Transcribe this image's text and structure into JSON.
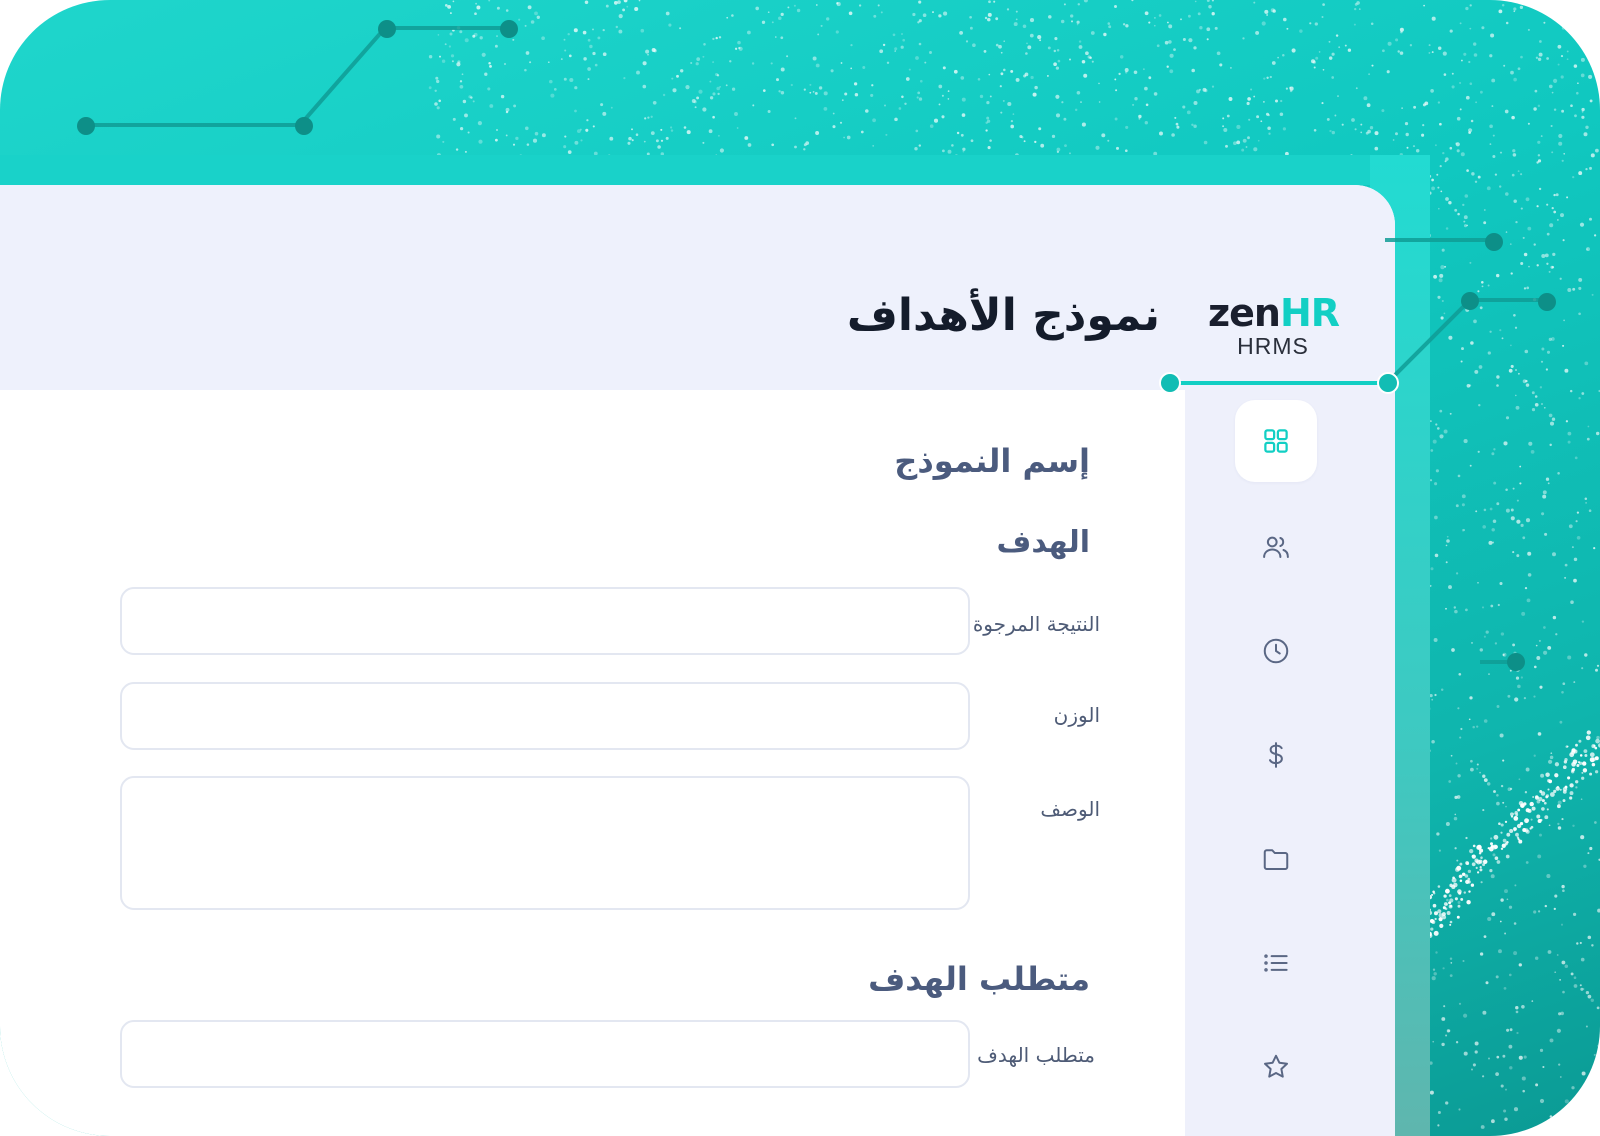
{
  "app": {
    "logo_main_a": "zen",
    "logo_main_b": "HR",
    "logo_sub": "HRMS",
    "page_title": "نموذج الأهداف"
  },
  "form": {
    "template_name_title": "إسم النموذج",
    "goal_section_title": "الهدف",
    "expected_result_label": "النتيجة المرجوة",
    "weight_label": "الوزن",
    "description_label": "الوصف",
    "requirement_section_title": "متطلب الهدف",
    "requirement_label": "متطلب الهدف",
    "expected_result_value": "",
    "weight_value": "",
    "description_value": "",
    "requirement_value": ""
  },
  "sidebar": {
    "items": [
      {
        "icon": "dashboard-grid-icon",
        "active": true
      },
      {
        "icon": "users-icon",
        "active": false
      },
      {
        "icon": "clock-icon",
        "active": false
      },
      {
        "icon": "dollar-icon",
        "active": false
      },
      {
        "icon": "folder-icon",
        "active": false
      },
      {
        "icon": "list-icon",
        "active": false
      },
      {
        "icon": "star-icon",
        "active": false
      }
    ]
  },
  "colors": {
    "brand_teal": "#12cfc4",
    "header_bg": "#eef1fc",
    "sidebar_bg": "#eef0fb",
    "title_text": "#141c2b",
    "label_text": "#4e5b76",
    "section_text": "#4b5b7e",
    "icon_color": "#5a6784"
  }
}
